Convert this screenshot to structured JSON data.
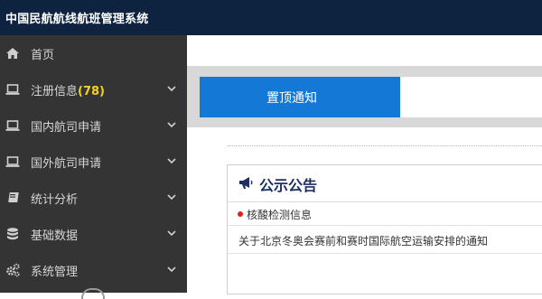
{
  "app": {
    "title": "中国民航航线航班管理系统"
  },
  "sidebar": {
    "items": [
      {
        "label": "首页",
        "icon": "home-icon"
      },
      {
        "label": "注册信息",
        "badge": "(78)",
        "icon": "laptop-icon"
      },
      {
        "label": "国内航司申请",
        "icon": "laptop-icon"
      },
      {
        "label": "国外航司申请",
        "icon": "laptop-icon"
      },
      {
        "label": "统计分析",
        "icon": "book-icon"
      },
      {
        "label": "基础数据",
        "icon": "database-icon"
      },
      {
        "label": "系统管理",
        "icon": "gears-icon"
      }
    ]
  },
  "main": {
    "pinned_tab": "置顶通知",
    "announcement": {
      "title": "公示公告",
      "items": [
        "核酸检测信息",
        "关于北京冬奥会赛前和赛时国际航空运输安排的通知"
      ]
    }
  },
  "colors": {
    "topbar": "#0e2340",
    "sidebar": "#343434",
    "accent": "#1479d6",
    "badge": "#f5d21a"
  }
}
